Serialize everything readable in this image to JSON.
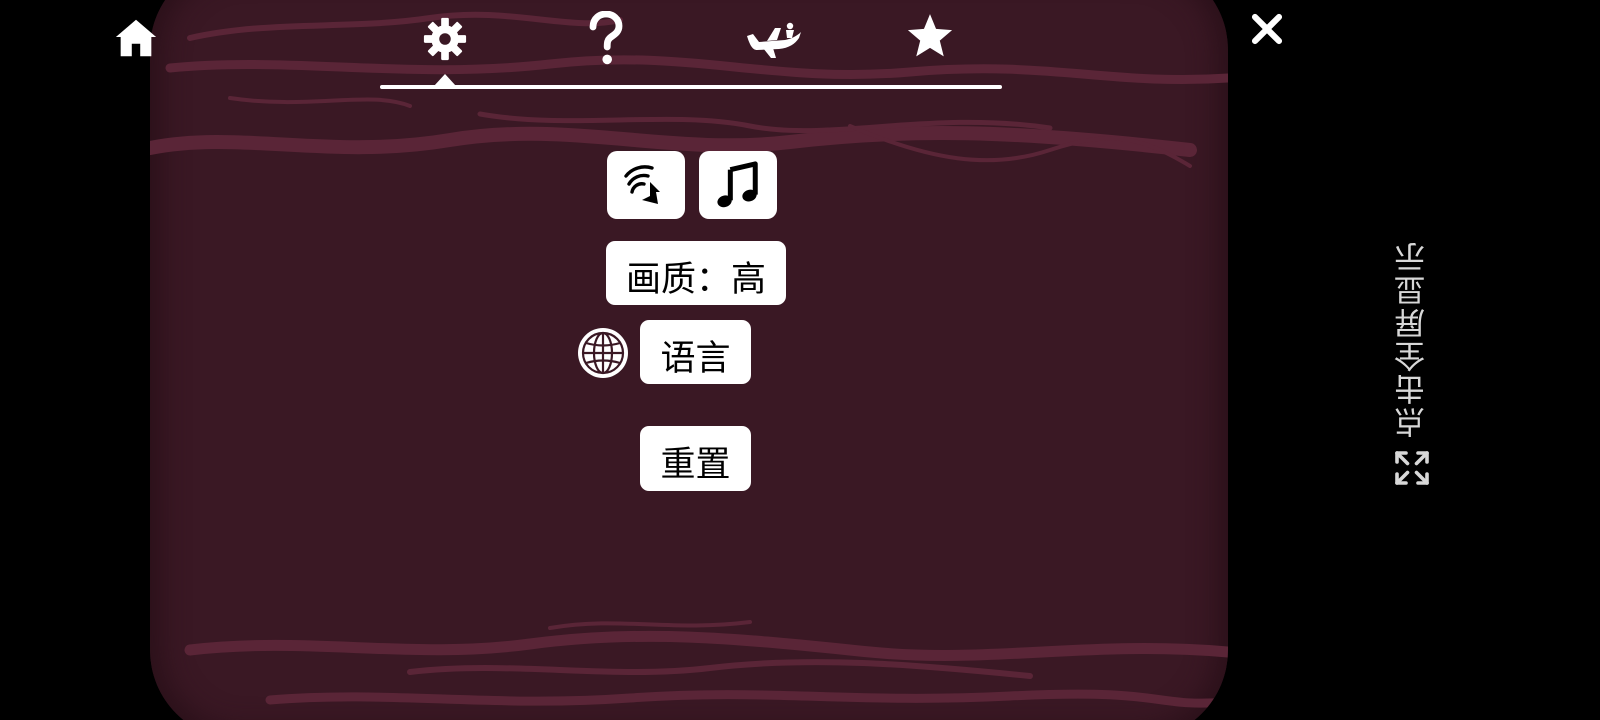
{
  "top_nav": {
    "home_icon": "home-icon",
    "tabs": [
      {
        "icon": "gear-icon",
        "selected": true
      },
      {
        "icon": "question-icon",
        "selected": false
      },
      {
        "icon": "airplane-icon",
        "selected": false
      },
      {
        "icon": "star-icon",
        "selected": false
      }
    ],
    "close_icon": "close-icon"
  },
  "settings": {
    "sound_icon": "sound-effects-icon",
    "music_icon": "music-note-icon",
    "quality_label": "画质：高",
    "language_icon": "globe-icon",
    "language_label": "语言",
    "reset_label": "重置"
  },
  "fullscreen_hint": {
    "label": "点击全屏显示",
    "icon": "expand-icon"
  },
  "colors": {
    "panel_bg": "#3a1824",
    "wave": "#5a2537",
    "foreground": "#ffffff"
  }
}
